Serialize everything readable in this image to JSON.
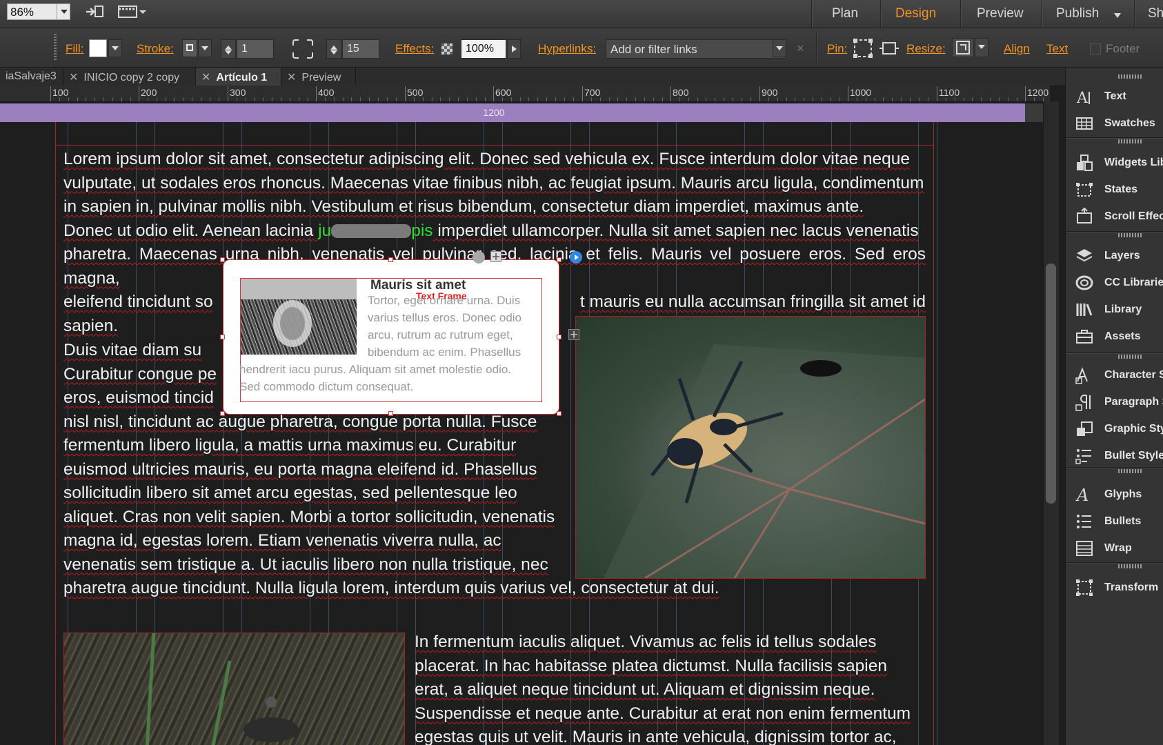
{
  "menubar": {
    "zoom": "86%",
    "modes": [
      "Plan",
      "Design",
      "Preview",
      "Publish",
      "Sh"
    ],
    "active_mode": "Design"
  },
  "controlbar": {
    "fill_label": "Fill:",
    "stroke_label": "Stroke:",
    "stroke_value": "1",
    "corner_value": "15",
    "effects_label": "Effects:",
    "opacity_value": "100%",
    "hyperlinks_label": "Hyperlinks:",
    "hyperlinks_value": "Add or filter links",
    "pin_label": "Pin:",
    "resize_label": "Resize:",
    "align_label": "Align",
    "text_label": "Text",
    "footer_label": "Footer"
  },
  "tabs": [
    {
      "label": "iaSalvaje3"
    },
    {
      "label": "INICIO copy 2 copy"
    },
    {
      "label": "Artículo 1"
    },
    {
      "label": "Preview"
    }
  ],
  "ruler": {
    "labels": [
      "100",
      "200",
      "300",
      "400",
      "500",
      "600",
      "700",
      "800",
      "900",
      "1000",
      "1100",
      "1200"
    ]
  },
  "breakpoint": {
    "label": "1200"
  },
  "content": {
    "p1_lines": [
      "Lorem ipsum dolor sit amet, consectetur adipiscing elit. Donec sed vehicula ex. Fusce interdum dolor vitae neque",
      "vulputate, ut sodales eros rhoncus. Maecenas vitae finibus nibh, ac feugiat ipsum. Mauris arcu ligula, condimentum",
      "in sapien in, pulvinar mollis nibh. Vestibulum et risus bibendum, consectetur diam imperdiet, maximus ante."
    ],
    "p1_line4_a": "Donec ut odio elit. Aenean lacinia ",
    "p1_line4_link_a": "ju",
    "p1_line4_link_b": "pis",
    "p1_line4_b": " imperdiet ullamcorper. Nulla sit amet sapien nec lacus venenatis",
    "p1_line5": "pharetra. Maecenas urna nibh, venenatis vel pulvinar sed, lacinia et felis. Mauris vel posuere eros. Sed eros magna,",
    "p1_line6_a": "eleifend tincidunt so",
    "p1_line6_b": "t mauris eu nulla accumsan fringilla sit amet id",
    "p1_line7": "sapien.",
    "p2_partials": [
      "Duis vitae diam su",
      "Curabitur congue pe",
      "eros, euismod tincid"
    ],
    "p2_lines": [
      "nisl nisl, tincidunt ac augue pharetra, congue porta nulla. Fusce",
      "fermentum libero ligula, a mattis urna maximus eu. Curabitur",
      "euismod ultricies mauris, eu porta magna eleifend id. Phasellus",
      "sollicitudin libero sit amet arcu egestas, sed pellentesque leo",
      "aliquet. Cras non velit sapien. Morbi a tortor sollicitudin, venenatis",
      "magna id, egestas lorem. Etiam venenatis viverra nulla, ac",
      "venenatis sem tristique a. Ut iaculis libero non nulla tristique, nec"
    ],
    "p2_last": "pharetra augue tincidunt. Nulla ligula lorem, interdum quis varius vel, consectetur at dui.",
    "p3_lines": [
      "In fermentum iaculis aliquet. Vivamus ac felis id tellus sodales",
      "placerat. In hac habitasse platea dictumst. Nulla facilisis sapien",
      "erat, a aliquet neque tincidunt ut. Aliquam et dignissim neque.",
      "Suspendisse et neque ante. Curabitur at erat non enim fermentum",
      "egestas quis ut velit. Mauris in ante vehicula, dignissim tortor ac,"
    ]
  },
  "widget": {
    "title": "Mauris sit amet",
    "frame_label": "Text Frame",
    "body_lines": [
      "Tortor, eget ornare urna. Duis",
      "varius tellus eros. Donec odio",
      "arcu, rutrum ac rutrum eget,",
      "bibendum ac enim. Phasellus"
    ],
    "body_full": [
      "hendrerit iacu purus. Aliquam sit amet molestie odio.",
      "Sed commodo dictum consequat."
    ]
  },
  "panel": {
    "items": [
      "Text",
      "Swatches",
      "Widgets Lib",
      "States",
      "Scroll Effect",
      "Layers",
      "CC Librarie",
      "Library",
      "Assets",
      "Character S",
      "Paragraph S",
      "Graphic Sty",
      "Bullet Style",
      "Glyphs",
      "Bullets",
      "Wrap",
      "Transform"
    ]
  },
  "colors": {
    "accent": "#f39224",
    "breakpoint": "#9b7fbf",
    "link": "#2ee02e",
    "frame_red": "#d63b3b"
  }
}
